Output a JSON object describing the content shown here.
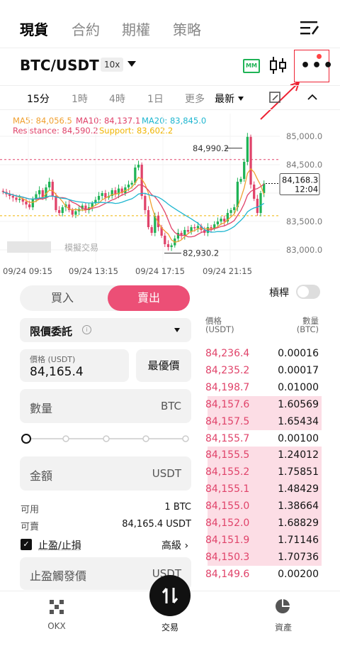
{
  "nav": {
    "tabs": [
      "現貨",
      "合約",
      "期權",
      "策略"
    ],
    "active": 0
  },
  "pair": {
    "symbol": "BTC/USDT",
    "leverage": "10x",
    "mm_badge": "MM"
  },
  "intervals": {
    "items": [
      "15分",
      "1時",
      "4時",
      "1日",
      "更多"
    ],
    "active": 0,
    "latest": "最新"
  },
  "indicators": {
    "ma5": "MA5: 84,056.5",
    "ma10": "MA10: 84,137.1",
    "ma20": "MA20: 83,845.0",
    "resistance": "Resistance: 84,590.2",
    "support": "Support: 83,602.2",
    "colors": {
      "ma5": "#f0a030",
      "ma10": "#e0436a",
      "ma20": "#1fb6d0",
      "resistance": "#e0436a",
      "support": "#f0b400"
    }
  },
  "chart_data": {
    "type": "candlestick",
    "y_ticks": [
      "85,000.0",
      "84,500.0",
      "84,000.0",
      "83,500.0",
      "83,000.0"
    ],
    "ylim": [
      82900,
      85150
    ],
    "x_ticks": [
      "09/24 09:15",
      "09/24 13:15",
      "09/24 17:15",
      "09/24 21:15"
    ],
    "high_label": "84,990.2",
    "low_label": "82,930.2",
    "current_price": "84,168.3",
    "countdown": "12:04",
    "resistance": 84590.2,
    "support": 83602.2,
    "watermark": "模擬交易",
    "closes": [
      84020,
      83980,
      83950,
      83920,
      83880,
      83900,
      83850,
      83800,
      83750,
      83900,
      83980,
      84050,
      83920,
      84100,
      84200,
      83950,
      83700,
      83650,
      83750,
      83800,
      83700,
      83620,
      83680,
      83720,
      83780,
      83700,
      83750,
      83820,
      83880,
      83950,
      84000,
      83920,
      83950,
      84050,
      83980,
      84080,
      84000,
      84100,
      84150,
      84180,
      84450,
      84500,
      83950,
      83700,
      83400,
      83300,
      83600,
      83400,
      83250,
      83100,
      83050,
      83080,
      83200,
      83300,
      83250,
      83350,
      83320,
      83400,
      83380,
      83420,
      83350,
      83300,
      83400,
      83380,
      83450,
      83500,
      83550,
      83500,
      83650,
      83700,
      83750,
      84200,
      84250,
      84550,
      84990,
      84150,
      83900,
      83650,
      84000,
      84168
    ]
  },
  "trade": {
    "buy": "買入",
    "sell": "賣出",
    "leverage_label": "槓桿",
    "order_type": "限價委託",
    "info_icon": "i",
    "price_label": "價格 (USDT)",
    "price_value": "84,165.4",
    "best_price": "最優價",
    "qty_placeholder": "數量",
    "qty_unit": "BTC",
    "amount_placeholder": "金額",
    "amount_unit": "USDT",
    "available_label": "可用",
    "available_value": "1 BTC",
    "sellable_label": "可賣",
    "sellable_value": "84,165.4 USDT",
    "tpsl_label": "止盈/止損",
    "advanced": "高級 ›",
    "tp_trigger_placeholder": "止盈觸發價",
    "tp_trigger_unit": "USDT",
    "slider_level": 0
  },
  "orderbook": {
    "price_header": "價格\n(USDT)",
    "qty_header": "數量\n(BTC)",
    "price_header_1": "價格",
    "price_header_2": "(USDT)",
    "qty_header_1": "數量",
    "qty_header_2": "(BTC)",
    "rows": [
      {
        "price": "84,236.4",
        "qty": "0.00016",
        "depth": 0
      },
      {
        "price": "84,235.2",
        "qty": "0.00017",
        "depth": 0
      },
      {
        "price": "84,198.7",
        "qty": "0.01000",
        "depth": 0
      },
      {
        "price": "84,157.6",
        "qty": "1.60569",
        "depth": 0.97
      },
      {
        "price": "84,157.5",
        "qty": "1.65434",
        "depth": 0.97
      },
      {
        "price": "84,155.7",
        "qty": "0.00100",
        "depth": 0
      },
      {
        "price": "84,155.5",
        "qty": "1.24012",
        "depth": 0.97
      },
      {
        "price": "84,155.2",
        "qty": "1.75851",
        "depth": 0.97
      },
      {
        "price": "84,155.1",
        "qty": "1.48429",
        "depth": 0.97
      },
      {
        "price": "84,155.0",
        "qty": "1.38664",
        "depth": 0.97
      },
      {
        "price": "84,152.0",
        "qty": "1.68829",
        "depth": 0.97
      },
      {
        "price": "84,151.9",
        "qty": "1.71146",
        "depth": 0.97
      },
      {
        "price": "84,150.3",
        "qty": "1.70736",
        "depth": 0.97
      },
      {
        "price": "84,149.6",
        "qty": "0.00200",
        "depth": 0
      }
    ]
  },
  "bottom_nav": {
    "items": [
      "OKX",
      "交易",
      "資產"
    ],
    "active": 1
  }
}
